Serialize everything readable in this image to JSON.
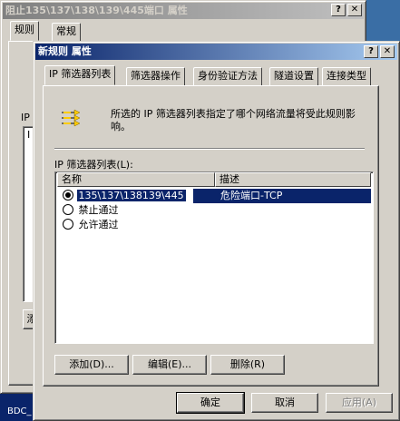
{
  "back_window": {
    "title": "阻止135\\137\\138\\139\\445端口  属性",
    "help_btn": "?",
    "close_btn": "✕",
    "tabs": [
      "规则",
      "常规"
    ],
    "frag_ip": "IP",
    "frag_i": "I",
    "frag_add": "添"
  },
  "dialog": {
    "title": "新规则 属性",
    "help_btn": "?",
    "close_btn": "✕",
    "tabs": [
      "IP 筛选器列表",
      "筛选器操作",
      "身份验证方法",
      "隧道设置",
      "连接类型"
    ],
    "selected_tab": 0,
    "description": "所选的 IP 筛选器列表指定了哪个网络流量将受此规则影响。",
    "list_label": "IP 筛选器列表(L):",
    "columns": [
      "名称",
      "描述"
    ],
    "rows": [
      {
        "name": "135\\137\\138139\\445",
        "desc": "危险端口-TCP",
        "checked": true,
        "selected": true
      },
      {
        "name": "禁止通过",
        "desc": "",
        "checked": false,
        "selected": false
      },
      {
        "name": "允许通过",
        "desc": "",
        "checked": false,
        "selected": false
      }
    ],
    "buttons": {
      "add": "添加(D)...",
      "edit": "编辑(E)...",
      "remove": "删除(R)"
    },
    "footer": {
      "ok": "确定",
      "cancel": "取消",
      "apply": "应用(A)"
    }
  },
  "taskbar": {
    "label": "BDC_"
  }
}
